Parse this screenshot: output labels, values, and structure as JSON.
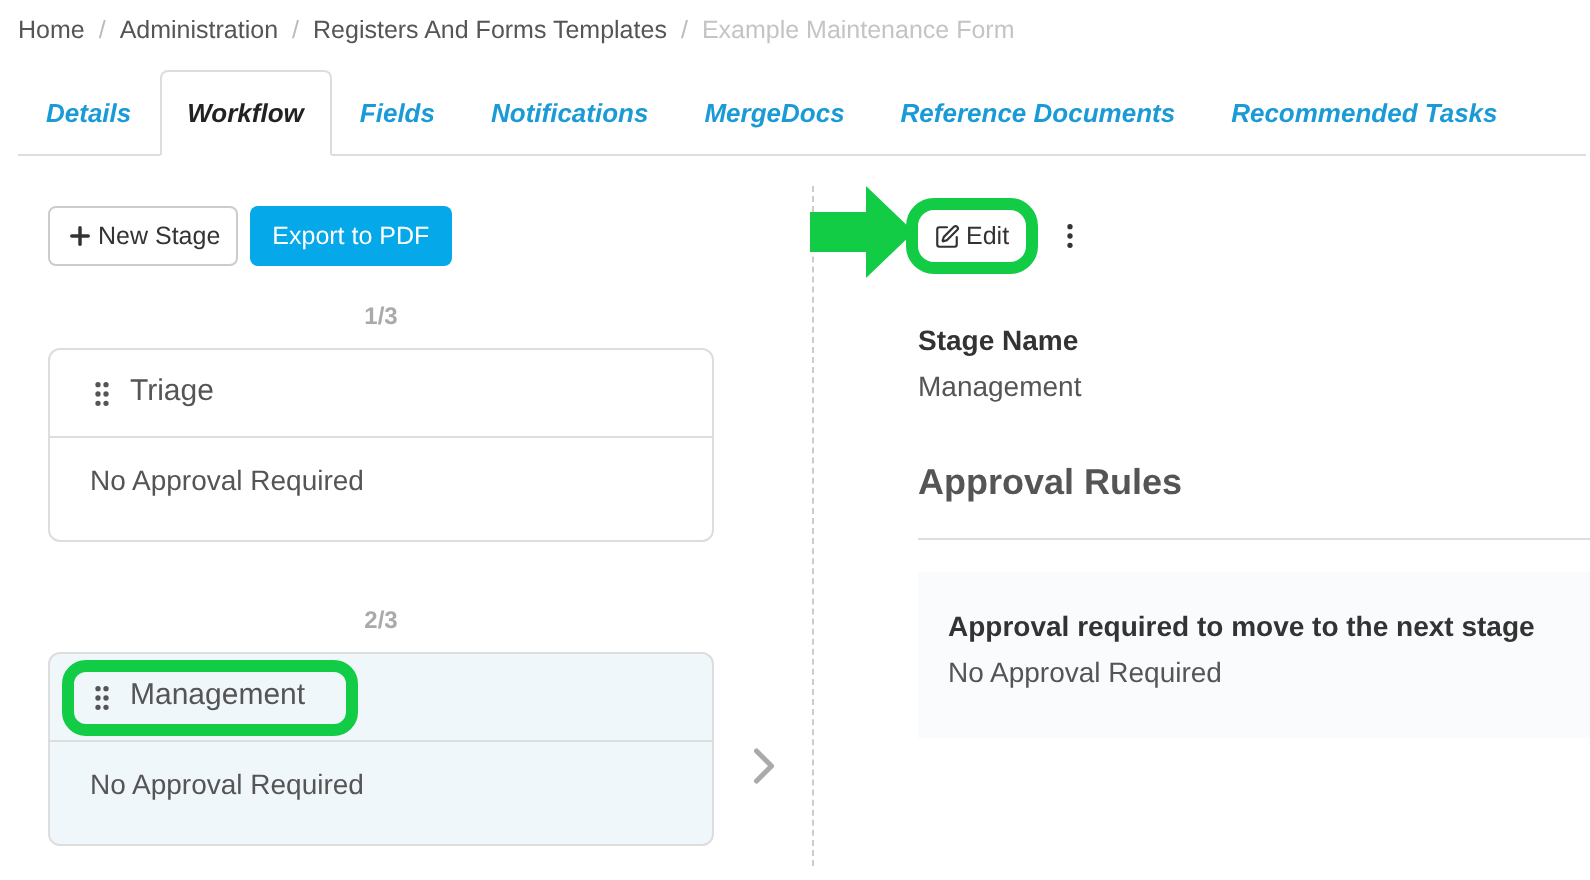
{
  "breadcrumb": [
    {
      "label": "Home",
      "current": false
    },
    {
      "label": "Administration",
      "current": false
    },
    {
      "label": "Registers And Forms Templates",
      "current": false
    },
    {
      "label": "Example Maintenance Form",
      "current": true
    }
  ],
  "breadcrumb_separator": "/",
  "tabs": [
    {
      "label": "Details",
      "selected": false
    },
    {
      "label": "Workflow",
      "selected": true
    },
    {
      "label": "Fields",
      "selected": false
    },
    {
      "label": "Notifications",
      "selected": false
    },
    {
      "label": "MergeDocs",
      "selected": false
    },
    {
      "label": "Reference Documents",
      "selected": false
    },
    {
      "label": "Recommended Tasks",
      "selected": false
    }
  ],
  "toolbar": {
    "new_stage": "New Stage",
    "export": "Export to PDF"
  },
  "stages": [
    {
      "position": "1/3",
      "name": "Triage",
      "approval": "No Approval Required",
      "selected": false,
      "highlighted": false
    },
    {
      "position": "2/3",
      "name": "Management",
      "approval": "No Approval Required",
      "selected": true,
      "highlighted": true
    }
  ],
  "detail": {
    "edit": {
      "label": "Edit",
      "highlighted": true,
      "pointer_arrow": true
    },
    "stage_name_label": "Stage Name",
    "stage_name": "Management",
    "approval_rules_title": "Approval Rules",
    "rule_label": "Approval required to move to the next stage",
    "rule_value": "No Approval Required"
  }
}
